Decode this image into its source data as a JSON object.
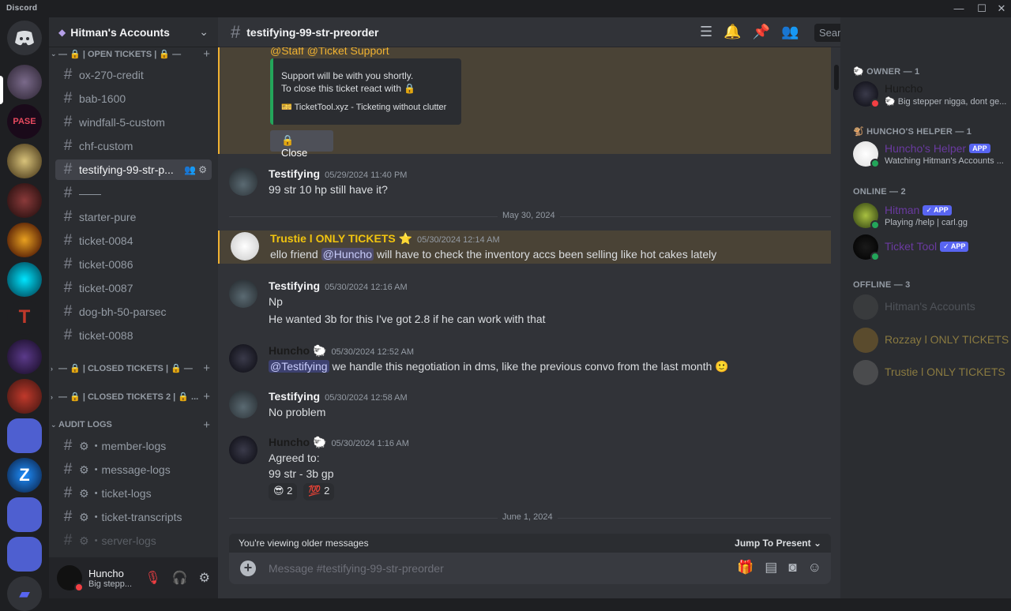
{
  "window": {
    "title": "Discord"
  },
  "server": {
    "name": "Hitman's Accounts"
  },
  "categories": {
    "open": "| OPEN TICKETS |",
    "closed": "| CLOSED TICKETS |",
    "closed2": "| CLOSED TICKETS 2 |",
    "audit": "AUDIT LOGS"
  },
  "channels": [
    "ox-270-credit",
    "bab-1600",
    "windfall-5-custom",
    "chf-custom",
    "testifying-99-str-p...",
    "——",
    "starter-pure",
    "ticket-0084",
    "ticket-0086",
    "ticket-0087",
    "dog-bh-50-parsec",
    "ticket-0088"
  ],
  "audit_channels": [
    "・member-logs",
    "・message-logs",
    "・ticket-logs",
    "・ticket-transcripts",
    "・server-logs"
  ],
  "user": {
    "name": "Huncho",
    "status": "Big stepp..."
  },
  "header": {
    "channel": "testifying-99-str-preorder",
    "search_placeholder": "Search"
  },
  "embed": {
    "mentions": "@Staff  @Ticket Support",
    "line1": "Support will be with you shortly.",
    "line2": "To close this ticket react with 🔒",
    "footer": "TicketTool.xyz - Ticketing without clutter",
    "close_label": "🔒 Close"
  },
  "messages": [
    {
      "author": "Testifying",
      "time": "05/29/2024 11:40 PM",
      "text": "99 str 10 hp still have it?"
    },
    {
      "author": "Trustie  l ONLY TICKETS ⭐",
      "time": "05/30/2024 12:14 AM",
      "text_pre": "ello friend ",
      "mention": "@Huncho",
      "text_post": " will have to check the inventory accs been selling like hot cakes lately"
    },
    {
      "author": "Testifying",
      "time": "05/30/2024 12:16 AM",
      "text": "Np",
      "text2": "He wanted 3b for this I've got 2.8 if he can work with that"
    },
    {
      "author": "Huncho 🐑",
      "time": "05/30/2024 12:52 AM",
      "mention": "@Testifying",
      "text_post": " we handle this negotiation in dms, like the previous convo from the last month 🙂"
    },
    {
      "author": "Testifying",
      "time": "05/30/2024 12:58 AM",
      "text": "No problem"
    },
    {
      "author": "Huncho 🐑",
      "time": "05/30/2024 1:16 AM",
      "text": "Agreed to:",
      "text2": "99 str - 3b gp"
    }
  ],
  "reactions": [
    "😎 2",
    "💯 2"
  ],
  "dividers": [
    "May 30, 2024",
    "June 1, 2024"
  ],
  "older_bar": {
    "text": "You're viewing older messages",
    "jump": "Jump To Present"
  },
  "composer": {
    "placeholder": "Message #testifying-99-str-preorder"
  },
  "member_groups": {
    "owner": "OWNER — 1",
    "helper": "HUNCHO'S HELPER — 1",
    "online": "ONLINE — 2",
    "offline": "OFFLINE — 3"
  },
  "members": {
    "huncho": {
      "name": "Huncho",
      "status": "🐑 Big stepper nigga, dont ge..."
    },
    "helper": {
      "name": "Huncho's Helper",
      "tag": "APP",
      "status": "Watching Hitman's Accounts ..."
    },
    "hitman": {
      "name": "Hitman",
      "tag": "✓ APP",
      "status": "Playing /help | carl.gg"
    },
    "tickettool": {
      "name": "Ticket Tool",
      "tag": "✓ APP"
    },
    "off1": "Hitman's Accounts",
    "off2": "Rozzay l ONLY TICKETS",
    "off3": "Trustie l ONLY TICKETS"
  },
  "colors": {
    "accent": "#5865f2",
    "highlight": "#f0b232",
    "online": "#23a55a",
    "dnd": "#f23f43",
    "helper_name": "#9b59b6",
    "trustie": "#f1c40f"
  }
}
